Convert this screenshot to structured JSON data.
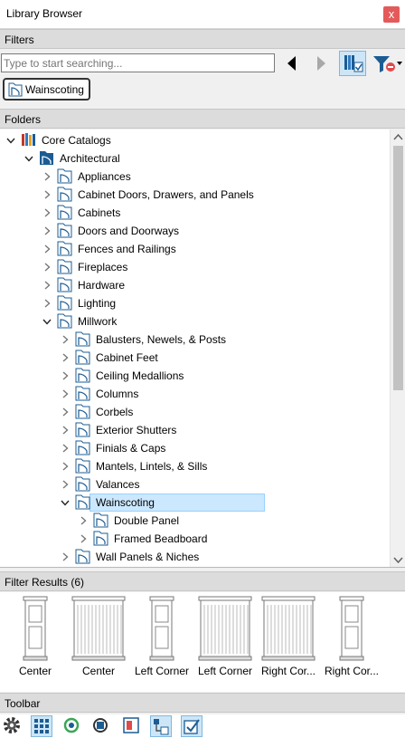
{
  "window": {
    "title": "Library Browser",
    "close_label": "x"
  },
  "filters": {
    "header": "Filters",
    "search_placeholder": "Type to start searching...",
    "chip_label": "Wainscoting"
  },
  "folders": {
    "header": "Folders",
    "tree": [
      {
        "label": "Core Catalogs",
        "level": 0,
        "state": "expanded",
        "icon": "books-icon"
      },
      {
        "label": "Architectural",
        "level": 1,
        "state": "expanded",
        "icon": "arch-folder-icon"
      },
      {
        "label": "Appliances",
        "level": 2,
        "state": "collapsed",
        "icon": "folder-icon"
      },
      {
        "label": "Cabinet Doors, Drawers, and Panels",
        "level": 2,
        "state": "collapsed",
        "icon": "folder-icon"
      },
      {
        "label": "Cabinets",
        "level": 2,
        "state": "collapsed",
        "icon": "folder-icon"
      },
      {
        "label": "Doors and Doorways",
        "level": 2,
        "state": "collapsed",
        "icon": "folder-icon"
      },
      {
        "label": "Fences and Railings",
        "level": 2,
        "state": "collapsed",
        "icon": "folder-icon"
      },
      {
        "label": "Fireplaces",
        "level": 2,
        "state": "collapsed",
        "icon": "folder-icon"
      },
      {
        "label": "Hardware",
        "level": 2,
        "state": "collapsed",
        "icon": "folder-icon"
      },
      {
        "label": "Lighting",
        "level": 2,
        "state": "collapsed",
        "icon": "folder-icon"
      },
      {
        "label": "Millwork",
        "level": 2,
        "state": "expanded",
        "icon": "folder-icon"
      },
      {
        "label": "Balusters, Newels, & Posts",
        "level": 3,
        "state": "collapsed",
        "icon": "folder-icon"
      },
      {
        "label": "Cabinet Feet",
        "level": 3,
        "state": "collapsed",
        "icon": "folder-icon"
      },
      {
        "label": "Ceiling Medallions",
        "level": 3,
        "state": "collapsed",
        "icon": "folder-icon"
      },
      {
        "label": "Columns",
        "level": 3,
        "state": "collapsed",
        "icon": "folder-icon"
      },
      {
        "label": "Corbels",
        "level": 3,
        "state": "collapsed",
        "icon": "folder-icon"
      },
      {
        "label": "Exterior Shutters",
        "level": 3,
        "state": "collapsed",
        "icon": "folder-icon"
      },
      {
        "label": "Finials & Caps",
        "level": 3,
        "state": "collapsed",
        "icon": "folder-icon"
      },
      {
        "label": "Mantels, Lintels, & Sills",
        "level": 3,
        "state": "collapsed",
        "icon": "folder-icon"
      },
      {
        "label": "Valances",
        "level": 3,
        "state": "collapsed",
        "icon": "folder-icon"
      },
      {
        "label": "Wainscoting",
        "level": 3,
        "state": "expanded",
        "icon": "folder-icon",
        "selected": true
      },
      {
        "label": "Double Panel",
        "level": 4,
        "state": "collapsed",
        "icon": "folder-icon"
      },
      {
        "label": "Framed Beadboard",
        "level": 4,
        "state": "collapsed",
        "icon": "folder-icon"
      },
      {
        "label": "Wall Panels & Niches",
        "level": 3,
        "state": "collapsed",
        "icon": "folder-icon"
      }
    ]
  },
  "results": {
    "header": "Filter Results (6)",
    "items": [
      {
        "label": "Center",
        "thumb": "panel-tall"
      },
      {
        "label": "Center",
        "thumb": "beadboard-wide"
      },
      {
        "label": "Left Corner",
        "thumb": "panel-tall"
      },
      {
        "label": "Left Corner",
        "thumb": "beadboard-wide"
      },
      {
        "label": "Right Cor...",
        "thumb": "beadboard-wide"
      },
      {
        "label": "Right Cor...",
        "thumb": "panel-tall"
      }
    ]
  },
  "toolbar": {
    "header": "Toolbar",
    "buttons": [
      {
        "name": "settings-gear-icon",
        "pressed": false
      },
      {
        "name": "grid-view-icon",
        "pressed": true
      },
      {
        "name": "refresh-library-icon",
        "pressed": false
      },
      {
        "name": "sync-library-icon",
        "pressed": false
      },
      {
        "name": "property-panel-icon",
        "pressed": false
      },
      {
        "name": "filter-tree-icon",
        "pressed": true
      },
      {
        "name": "check-filter-icon",
        "pressed": true
      }
    ]
  },
  "colors": {
    "selection": "#cce8ff",
    "selection_border": "#99d1ff",
    "accent_blue": "#1c5c93",
    "close": "#e45a5a"
  }
}
